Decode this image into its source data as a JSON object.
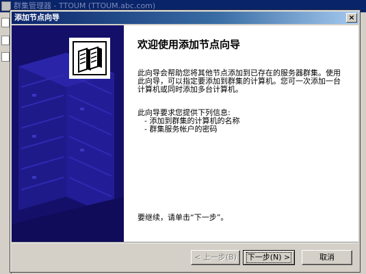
{
  "background_window": {
    "title": "群集管理器 - TTOUM (TTOUM.abc.com)"
  },
  "dialog": {
    "title": "添加节点向导",
    "close_label": "×",
    "heading": "欢迎使用添加节点向导",
    "intro": "此向导会帮助您将其他节点添加到已存在的服务器群集。使用此向导，可以指定要添加到群集的计算机。您可一次添加一台计算机或同时添加多台计算机。",
    "requirements_intro": "此向导要求您提供下列信息:",
    "requirements": [
      "-  添加到群集的计算机的名称",
      "-  群集服务帐户的密码"
    ],
    "continue_text": "要继续，请单击“下一步”。"
  },
  "buttons": {
    "back": "< 上一步(B)",
    "next": "下一步(N) >",
    "cancel": "取消"
  },
  "colors": {
    "art_background": "#14106a",
    "title_bar": "#0a246a"
  }
}
